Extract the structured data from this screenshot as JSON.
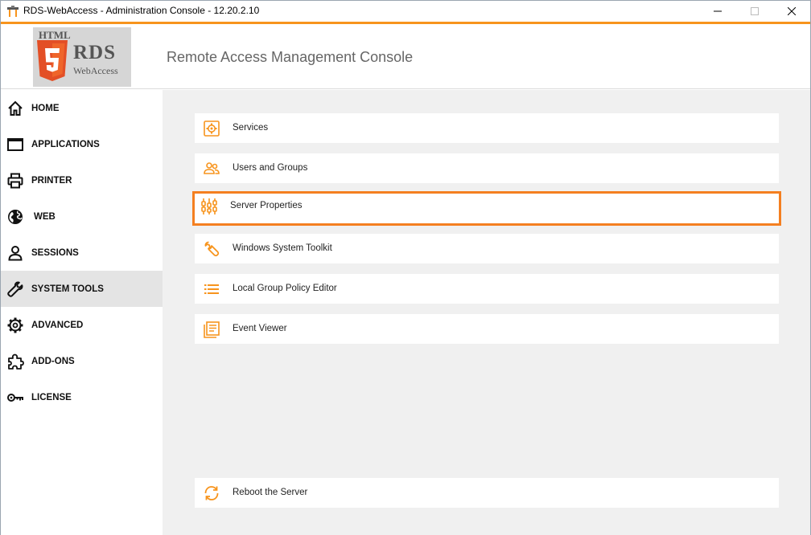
{
  "window": {
    "title": "RDS-WebAccess - Administration Console - 12.20.2.10"
  },
  "header": {
    "logo_html": "HTML",
    "logo_rds": "RDS",
    "logo_webaccess": "WebAccess",
    "console_title": "Remote Access Management Console"
  },
  "sidebar": {
    "items": [
      {
        "label": "HOME",
        "icon": "home-icon"
      },
      {
        "label": "APPLICATIONS",
        "icon": "window-icon"
      },
      {
        "label": "PRINTER",
        "icon": "printer-icon"
      },
      {
        "label": "WEB",
        "icon": "globe-icon"
      },
      {
        "label": "SESSIONS",
        "icon": "person-icon"
      },
      {
        "label": "SYSTEM TOOLS",
        "icon": "wrench-icon"
      },
      {
        "label": "ADVANCED",
        "icon": "gear-icon"
      },
      {
        "label": "ADD-ONS",
        "icon": "puzzle-icon"
      },
      {
        "label": "LICENSE",
        "icon": "key-icon"
      }
    ],
    "active": "SYSTEM TOOLS"
  },
  "tools": {
    "items": [
      {
        "label": "Services",
        "icon": "services-gear-icon"
      },
      {
        "label": "Users and Groups",
        "icon": "users-icon"
      },
      {
        "label": "Server Properties",
        "icon": "sliders-icon"
      },
      {
        "label": "Windows System Toolkit",
        "icon": "wrench-icon"
      },
      {
        "label": "Local Group Policy Editor",
        "icon": "list-icon"
      },
      {
        "label": "Event Viewer",
        "icon": "event-viewer-icon"
      }
    ],
    "selected": "Server Properties",
    "reboot_label": "Reboot the Server"
  },
  "colors": {
    "accent": "#f7941d",
    "selection_border": "#f47f20",
    "icon_orange": "#f7941d",
    "active_nav": "#e4e4e4",
    "content_bg": "#f0f0f0"
  }
}
